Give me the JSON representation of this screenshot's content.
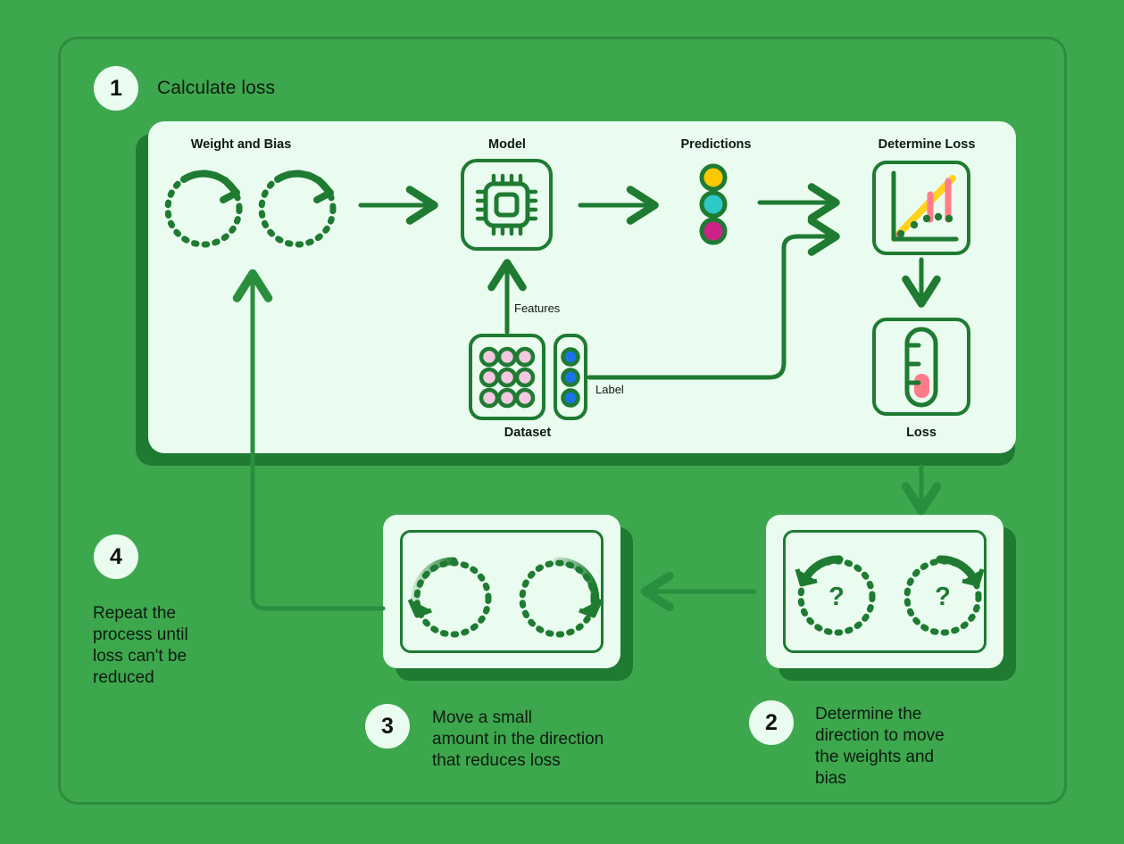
{
  "diagram": {
    "title": "Iterative machine learning training loop (gradient descent)",
    "background_color": "#3DA74E",
    "panel_color": "#EAFBEF",
    "line_color": "#1E7B31",
    "shadow_color": "#1F7A32"
  },
  "steps": [
    {
      "number": "1",
      "label": "Calculate loss"
    },
    {
      "number": "2",
      "label": "Determine the\ndirection to move\nthe weights and\nbias"
    },
    {
      "number": "3",
      "label": "Move a small\namount in the direction\nthat reduces loss"
    },
    {
      "number": "4",
      "label": "Repeat the\nprocess until\nloss can't be\nreduced"
    }
  ],
  "pipeline": {
    "headings": {
      "weight_and_bias": "Weight and Bias",
      "model": "Model",
      "predictions": "Predictions",
      "determine_loss": "Determine Loss"
    },
    "captions": {
      "dataset": "Dataset",
      "loss": "Loss"
    },
    "edge_labels": {
      "features": "Features",
      "label": "Label"
    },
    "icons": {
      "model": "cpu-chip-icon",
      "determine_loss": "scatter-plot-residuals-icon",
      "loss": "thermometer-icon",
      "weight_dial": "rotating-dial-icon",
      "dataset_features": "feature-grid-icon",
      "dataset_label": "label-column-icon"
    }
  },
  "chart_data": {
    "type": "scatter",
    "title": "Determine Loss",
    "points_x": [
      1,
      2,
      3,
      4,
      5
    ],
    "points_y": [
      1,
      2,
      3,
      3.6,
      4.2
    ],
    "fit_line": {
      "from": [
        0.6,
        0.7
      ],
      "to": [
        5.6,
        6.0
      ],
      "color": "#FFD21E"
    },
    "residuals": [
      {
        "x": 4,
        "from": 3.6,
        "to": 4.9,
        "color": "#FF7D8A"
      },
      {
        "x": 5,
        "from": 4.2,
        "to": 5.8,
        "color": "#FF7D8A"
      }
    ],
    "point_color": "#1E7B31",
    "grid": false,
    "xlabel": "",
    "ylabel": ""
  },
  "colors": {
    "prediction_yellow": "#FFC800",
    "prediction_cyan": "#2DC8C8",
    "prediction_magenta": "#CC2288",
    "feature_pink": "#F3C8E0",
    "label_blue": "#1A73E8",
    "loss_fill": "#FF7D8A",
    "trend_yellow": "#FFD21E"
  },
  "dials": {
    "step1": [
      "weight-dial",
      "bias-dial"
    ],
    "step2_marks": [
      "?",
      "?"
    ],
    "step3": [
      "weight-dial-moved",
      "bias-dial-moved"
    ]
  },
  "predictions": [
    "prediction-dot-yellow",
    "prediction-dot-cyan",
    "prediction-dot-magenta"
  ]
}
